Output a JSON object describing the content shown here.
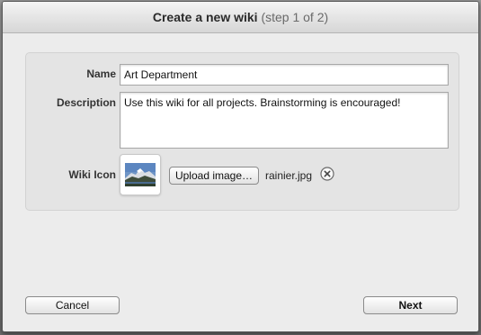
{
  "dialog": {
    "title": "Create a new wiki",
    "step": "(step 1 of 2)"
  },
  "form": {
    "name_label": "Name",
    "name_value": "Art Department",
    "description_label": "Description",
    "description_value": "Use this wiki for all projects. Brainstorming is encouraged!",
    "icon_label": "Wiki Icon",
    "upload_button": "Upload image…",
    "icon_filename": "rainier.jpg"
  },
  "footer": {
    "cancel_button": "Cancel",
    "next_button": "Next"
  },
  "icons": {
    "clear": "clear-x-circle-icon",
    "thumbnail": "mountain-photo-thumbnail"
  }
}
